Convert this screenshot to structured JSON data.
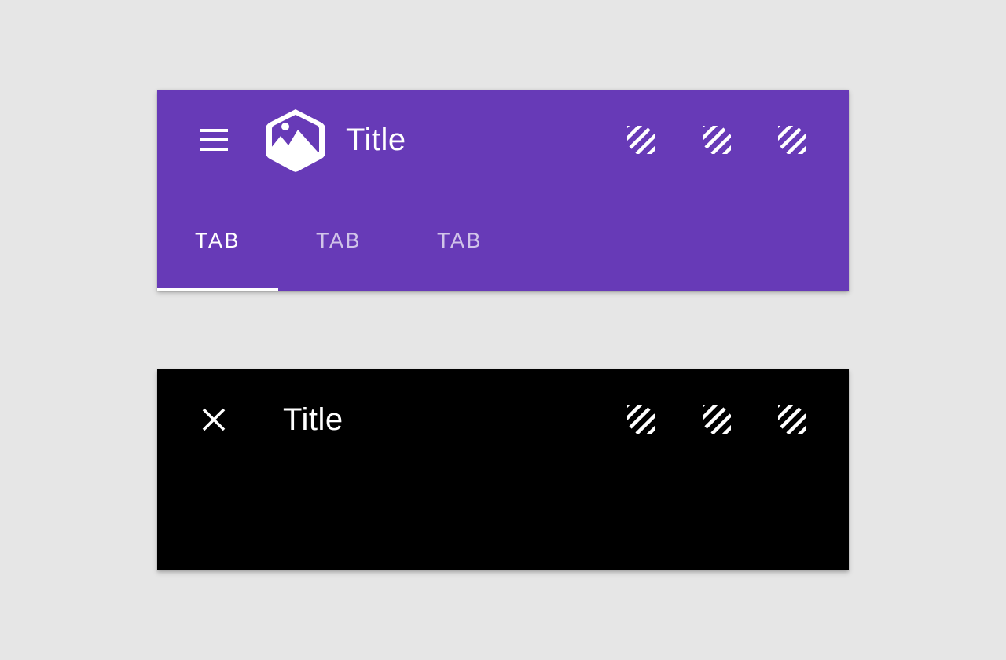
{
  "colors": {
    "background": "#e6e6e6",
    "primary_bar": "#673ab7",
    "contextual_bar": "#000000",
    "on_bar": "#ffffff",
    "tab_inactive": "#d1c4e9"
  },
  "primary_bar": {
    "nav_icon": "menu-icon",
    "logo_icon": "hexagon-image-logo",
    "title": "Title",
    "actions": [
      {
        "icon": "placeholder-action-icon"
      },
      {
        "icon": "placeholder-action-icon"
      },
      {
        "icon": "placeholder-action-icon"
      }
    ],
    "tabs": [
      {
        "label": "TAB",
        "selected": true
      },
      {
        "label": "TAB",
        "selected": false
      },
      {
        "label": "TAB",
        "selected": false
      }
    ]
  },
  "contextual_bar": {
    "nav_icon": "close-icon",
    "title": "Title",
    "actions": [
      {
        "icon": "placeholder-action-icon"
      },
      {
        "icon": "placeholder-action-icon"
      },
      {
        "icon": "placeholder-action-icon"
      }
    ]
  }
}
